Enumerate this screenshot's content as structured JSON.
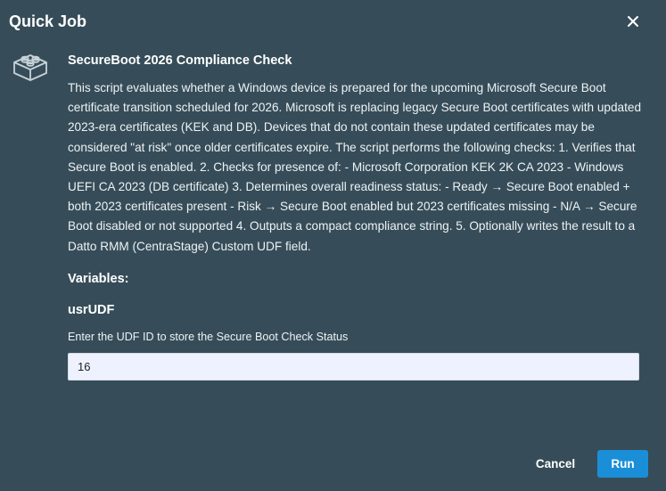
{
  "dialog": {
    "title": "Quick Job",
    "close_icon": "close-icon"
  },
  "script": {
    "icon": "component-block-icon",
    "title": "SecureBoot 2026 Compliance Check",
    "description": "This script evaluates whether a Windows device is prepared for the upcoming Microsoft Secure Boot certificate transition scheduled for 2026. Microsoft is replacing legacy Secure Boot certificates with updated 2023-era certificates (KEK and DB). Devices that do not contain these updated certificates may be considered \"at risk\" once older certificates expire. The script performs the following checks: 1. Verifies that Secure Boot is enabled. 2. Checks for presence of: - Microsoft Corporation KEK 2K CA 2023 - Windows UEFI CA 2023 (DB certificate) 3. Determines overall readiness status: - Ready → Secure Boot enabled + both 2023 certificates present - Risk → Secure Boot enabled but 2023 certificates missing - N/A → Secure Boot disabled or not supported 4. Outputs a compact compliance string. 5. Optionally writes the result to a Datto RMM (CentraStage) Custom UDF field."
  },
  "variables": {
    "heading": "Variables:",
    "items": [
      {
        "name": "usrUDF",
        "description": "Enter the UDF ID to store the Secure Boot Check Status",
        "value": "16"
      }
    ]
  },
  "footer": {
    "cancel_label": "Cancel",
    "run_label": "Run"
  },
  "colors": {
    "background": "#364d59",
    "primary_button": "#1a8fd8",
    "input_background": "#eef2fe"
  }
}
